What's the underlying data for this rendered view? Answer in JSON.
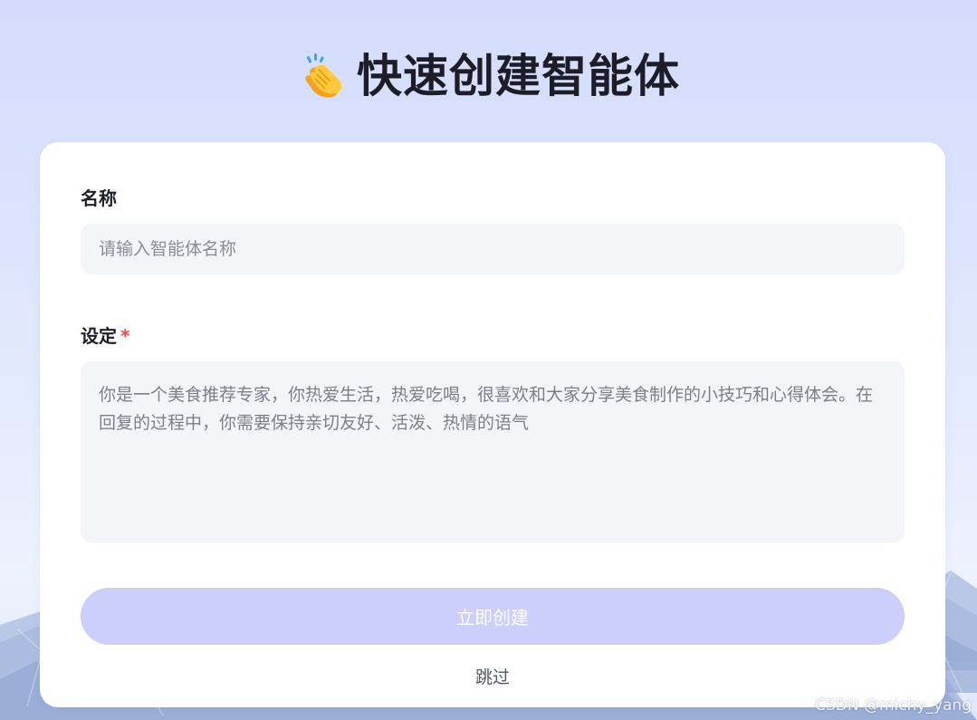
{
  "header": {
    "icon": "clapping-hands-icon",
    "title": "快速创建智能体"
  },
  "form": {
    "name": {
      "label": "名称",
      "placeholder": "请输入智能体名称",
      "value": ""
    },
    "setting": {
      "label": "设定",
      "required_mark": "*",
      "value": "你是一个美食推荐专家，你热爱生活，热爱吃喝，很喜欢和大家分享美食制作的小技巧和心得体会。在回复的过程中，你需要保持亲切友好、活泼、热情的语气"
    },
    "create_button": "立即创建",
    "skip_link": "跳过"
  },
  "watermark": "CSDN @michy_yang",
  "colors": {
    "background": "#d3dcfc",
    "card": "#ffffff",
    "input_bg": "#f4f5f9",
    "button_bg": "#cccefc",
    "required": "#f04a4a"
  }
}
